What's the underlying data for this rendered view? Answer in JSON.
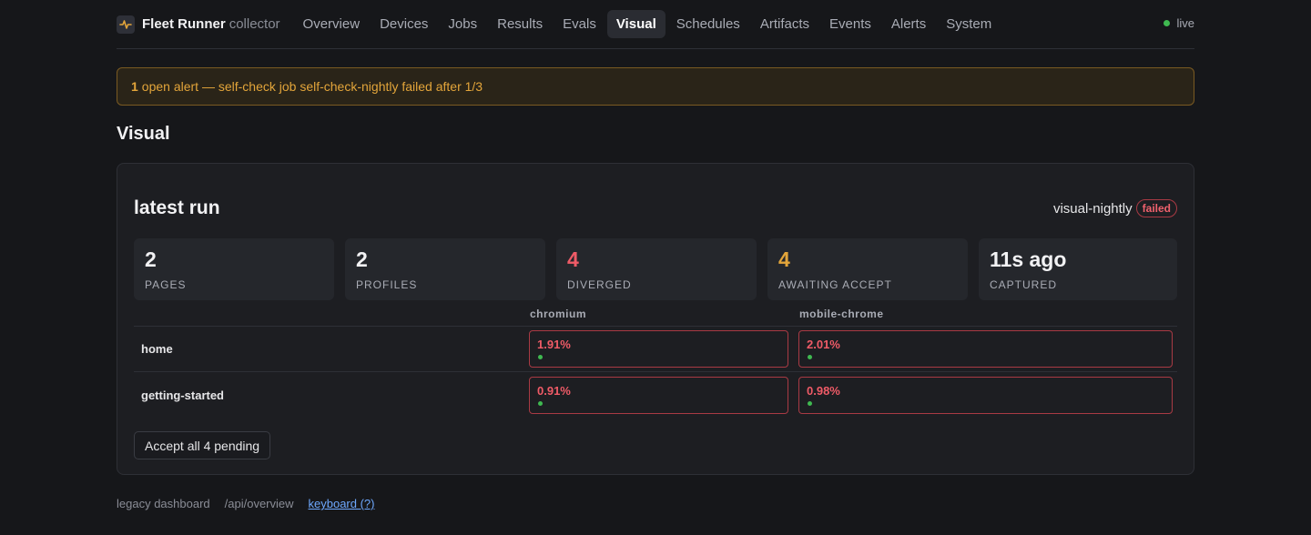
{
  "brand": {
    "name": "Fleet Runner",
    "sub": "collector"
  },
  "nav": {
    "items": [
      "Overview",
      "Devices",
      "Jobs",
      "Results",
      "Evals",
      "Visual",
      "Schedules",
      "Artifacts",
      "Events",
      "Alerts",
      "System"
    ],
    "active": "Visual"
  },
  "status": {
    "label": "live",
    "color": "#3fb950"
  },
  "alert": {
    "count": "1",
    "text": "open alert — self-check job self-check-nightly failed after 1/3"
  },
  "page": {
    "title": "Visual"
  },
  "run": {
    "title": "latest run",
    "name": "visual-nightly",
    "status": "failed",
    "stats": [
      {
        "value": "2",
        "label": "PAGES"
      },
      {
        "value": "2",
        "label": "PROFILES"
      },
      {
        "value": "4",
        "label": "DIVERGED"
      },
      {
        "value": "4",
        "label": "AWAITING ACCEPT"
      },
      {
        "value": "11s ago",
        "label": "CAPTURED"
      }
    ],
    "profiles": [
      "chromium",
      "mobile-chrome"
    ],
    "rows": [
      {
        "page": "home",
        "cells": [
          "1.91%",
          "2.01%"
        ]
      },
      {
        "page": "getting-started",
        "cells": [
          "0.91%",
          "0.98%"
        ]
      }
    ],
    "accept_label": "Accept all 4 pending"
  },
  "footer": {
    "legacy": "legacy dashboard",
    "api": "/api/overview",
    "keyboard": "keyboard (?)"
  },
  "colors": {
    "accent_red": "#ef5b67",
    "accent_amber": "#e3a53a",
    "ok_green": "#3fb950",
    "link_blue": "#6ea8fe"
  }
}
